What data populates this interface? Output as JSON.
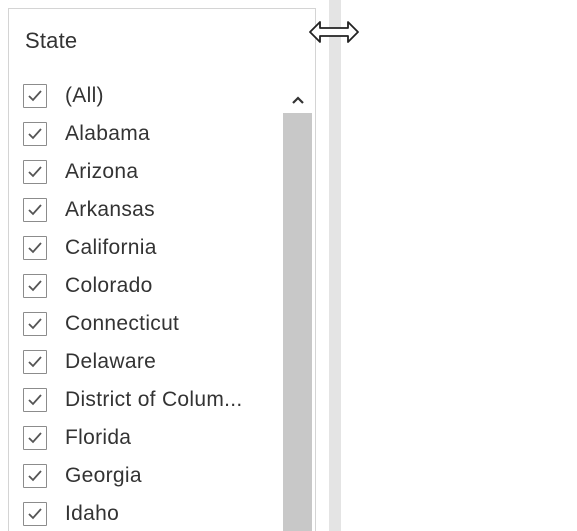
{
  "filter": {
    "title": "State",
    "items": [
      {
        "label": "(All)",
        "checked": true
      },
      {
        "label": "Alabama",
        "checked": true
      },
      {
        "label": "Arizona",
        "checked": true
      },
      {
        "label": "Arkansas",
        "checked": true
      },
      {
        "label": "California",
        "checked": true
      },
      {
        "label": "Colorado",
        "checked": true
      },
      {
        "label": "Connecticut",
        "checked": true
      },
      {
        "label": "Delaware",
        "checked": true
      },
      {
        "label": "District of Colum...",
        "checked": true
      },
      {
        "label": "Florida",
        "checked": true
      },
      {
        "label": "Georgia",
        "checked": true
      },
      {
        "label": "Idaho",
        "checked": true
      }
    ]
  },
  "icons": {
    "checkbox": "checkmark-icon",
    "scroll_up": "chevron-up-icon",
    "cursor": "horizontal-resize-cursor-icon"
  },
  "colors": {
    "text": "#333333",
    "checkbox_border": "#8c8c8c",
    "scrollbar_thumb": "#c8c8c8",
    "splitter": "#e4e4e4"
  }
}
